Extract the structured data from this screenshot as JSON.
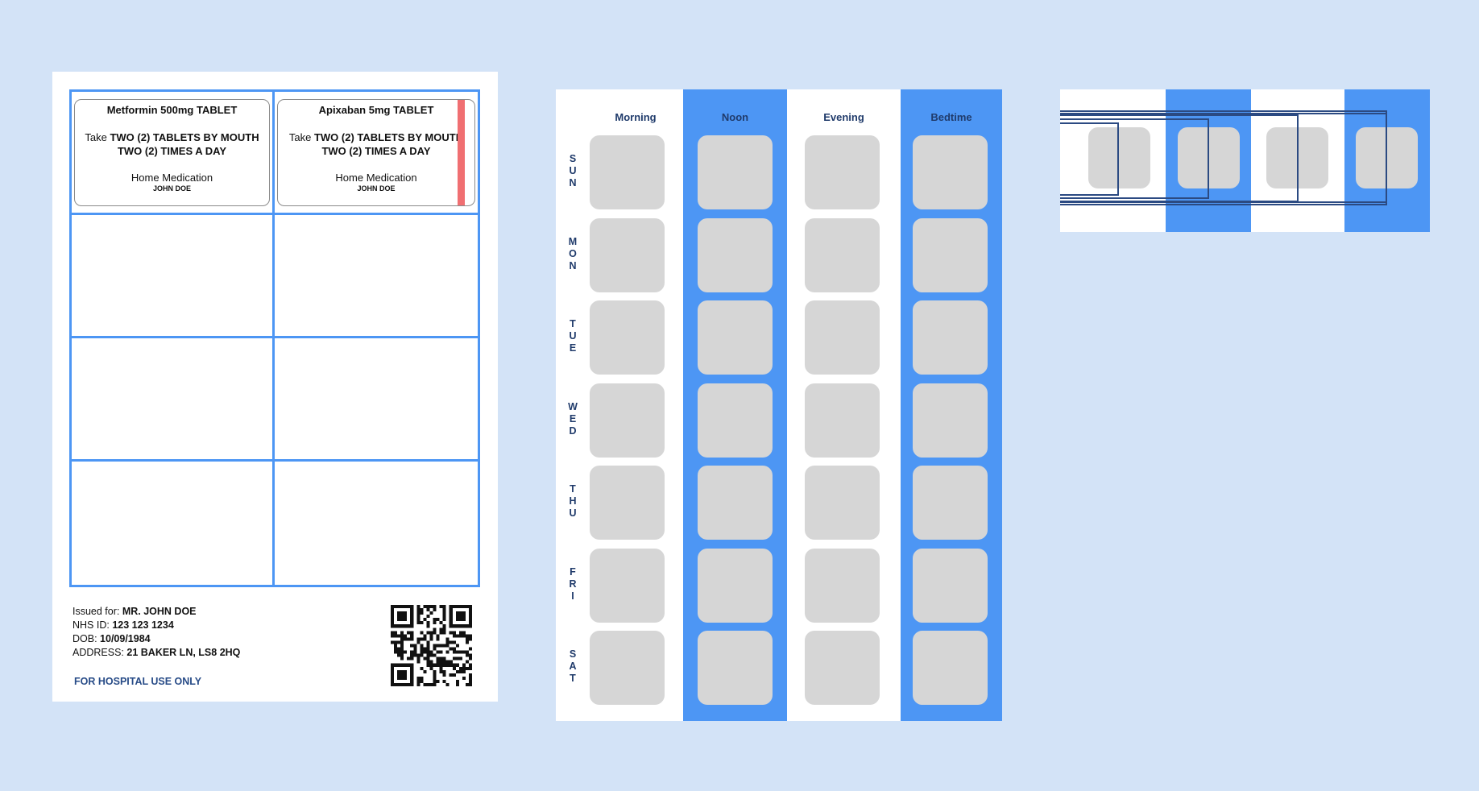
{
  "label_sheet": {
    "labels": [
      {
        "medication": "Metformin 500mg TABLET",
        "instruction_prefix": "Take ",
        "instruction_bold": "TWO (2) TABLETS BY MOUTH TWO (2) TIMES A DAY",
        "origin": "Home Medication",
        "patient": "JOHN DOE",
        "flagged": false
      },
      {
        "medication": "Apixaban 5mg TABLET",
        "instruction_prefix": "Take ",
        "instruction_bold": "TWO (2) TABLETS BY MOUTH TWO (2) TIMES A DAY",
        "origin": "Home Medication",
        "patient": "JOHN DOE",
        "flagged": true,
        "flag_color": "#f06f72"
      }
    ],
    "patient_info": {
      "issued_label": "Issued for: ",
      "issued_value": "MR. JOHN DOE",
      "nhs_label": "NHS ID: ",
      "nhs_value": "123 123 1234",
      "dob_label": "DOB: ",
      "dob_value": "10/09/1984",
      "address_label": "ADDRESS: ",
      "address_value": "21 BAKER LN, LS8 2HQ"
    },
    "footer": "FOR HOSPITAL USE ONLY",
    "qr_icon": "qr-code-icon"
  },
  "organiser": {
    "columns": [
      "Morning",
      "Noon",
      "Evening",
      "Bedtime"
    ],
    "days": [
      "SUN",
      "MON",
      "TUE",
      "WED",
      "THU",
      "FRI",
      "SAT"
    ]
  },
  "colors": {
    "background": "#d3e3f7",
    "accent_blue": "#4d96f4",
    "navy_text": "#203b6b",
    "compartment_grey": "#d6d6d6",
    "flag_red": "#f06f72"
  }
}
